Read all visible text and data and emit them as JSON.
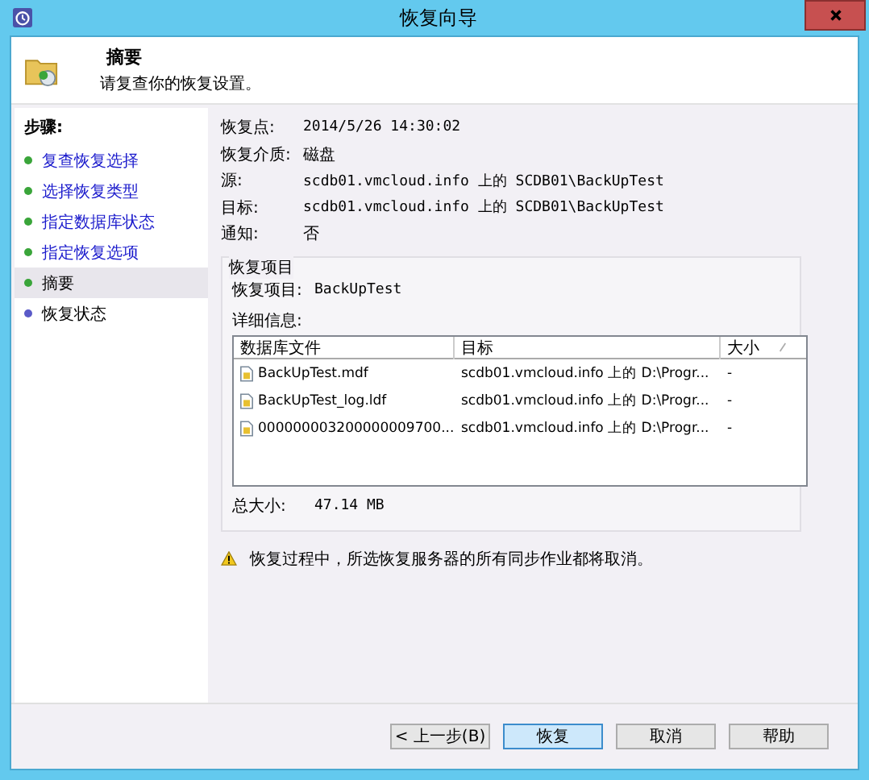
{
  "window": {
    "title": "恢复向导"
  },
  "header": {
    "title": "摘要",
    "subtitle": "请复查你的恢复设置。"
  },
  "steps": {
    "title": "步骤:",
    "items": [
      {
        "label": "复查恢复选择",
        "kind": "link",
        "selected": false,
        "color": "#3aa53a"
      },
      {
        "label": "选择恢复类型",
        "kind": "link",
        "selected": false,
        "color": "#3aa53a"
      },
      {
        "label": "指定数据库状态",
        "kind": "link",
        "selected": false,
        "color": "#3aa53a"
      },
      {
        "label": "指定恢复选项",
        "kind": "link",
        "selected": false,
        "color": "#3aa53a"
      },
      {
        "label": "摘要",
        "kind": "text",
        "selected": true,
        "color": "#3aa53a"
      },
      {
        "label": "恢复状态",
        "kind": "text",
        "selected": false,
        "color": "#5a5ac8"
      }
    ]
  },
  "summary": [
    {
      "label": "恢复点:",
      "value": "2014/5/26 14:30:02",
      "mono": true
    },
    {
      "label": "恢复介质:",
      "value": "磁盘",
      "mono": false
    },
    {
      "label": "源:",
      "value": "scdb01.vmcloud.info 上的 SCDB01\\BackUpTest",
      "mono": true
    },
    {
      "label": "目标:",
      "value": "scdb01.vmcloud.info 上的 SCDB01\\BackUpTest",
      "mono": true
    },
    {
      "label": "通知:",
      "value": "否",
      "mono": false
    }
  ],
  "recovery_items": {
    "title": "恢复项目",
    "item_label": "恢复项目:",
    "item_value": "BackUpTest",
    "details_label": "详细信息:",
    "table": {
      "columns": [
        "数据库文件",
        "目标",
        "大小"
      ],
      "rows": [
        [
          "BackUpTest.mdf",
          "scdb01.vmcloud.info 上的 D:\\Progr...",
          "-"
        ],
        [
          "BackUpTest_log.ldf",
          "scdb01.vmcloud.info 上的 D:\\Progr...",
          "-"
        ],
        [
          "000000003200000009700...",
          "scdb01.vmcloud.info 上的 D:\\Progr...",
          "-"
        ]
      ]
    },
    "total_label": "总大小:",
    "total_value": "47.14 MB"
  },
  "warning": "恢复过程中，所选恢复服务器的所有同步作业都将取消。",
  "buttons": [
    {
      "label": "< 上一步(B)",
      "default": false
    },
    {
      "label": "恢复",
      "default": true
    },
    {
      "label": "取消",
      "default": false
    },
    {
      "label": "帮助",
      "default": false
    }
  ]
}
